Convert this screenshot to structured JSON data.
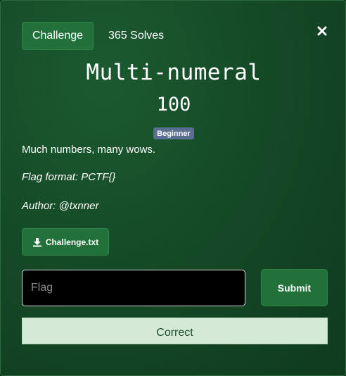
{
  "tabs": {
    "challenge_label": "Challenge",
    "solves_label": "365 Solves"
  },
  "challenge": {
    "name": "Multi-numeral",
    "value": "100",
    "tag": "Beginner",
    "description": [
      "Much numbers, many wows.",
      "Flag format: PCTF{}",
      "Author: @txnner"
    ],
    "file_name": "Challenge.txt"
  },
  "form": {
    "flag_placeholder": "Flag",
    "submit_label": "Submit"
  },
  "result": {
    "message": "Correct"
  },
  "icons": {
    "close": "close-icon",
    "download": "download-icon"
  },
  "colors": {
    "accent": "#22703a",
    "tag": "#5a6e8f",
    "success_bg": "#d4ead6",
    "success_text": "#1e4d2a"
  }
}
